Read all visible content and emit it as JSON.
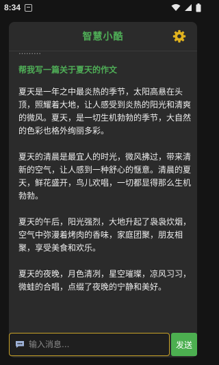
{
  "status_bar": {
    "time": "8:34"
  },
  "header": {
    "title": "智慧小酷"
  },
  "chat": {
    "previous_snippet": "………",
    "prompt": "帮我写一篇关于夏天的作文",
    "response_paragraphs": [
      "夏天是一年之中最炎热的季节，太阳高悬在头顶，照耀着大地，让人感受到炎热的阳光和清爽的微风。夏天，是一切生机勃勃的季节，大自然的色彩也格外绚丽多彩。",
      "夏天的清晨是最宜人的时光，微风拂过，带来清新的空气，让人感到一种舒心的惬意。清晨的夏天，鲜花盛开，鸟儿欢唱，一切都显得那么生机勃勃。",
      "夏天的午后，阳光强烈，大地升起了袅袅炊烟，空气中弥漫着烤肉的香味，家庭团聚，朋友相聚，享受美食和欢乐。",
      "夏天的夜晚，月色清冽，星空璀璨，凉风习习，微蛙的合唱，点缀了夜晚的宁静和美好。"
    ]
  },
  "input": {
    "placeholder": "输入消息...",
    "value": ""
  },
  "send_label": "发送",
  "colors": {
    "accent_green": "#4fae57",
    "input_border": "#c9a227",
    "gear": "#e0b21e"
  },
  "icons": [
    "notification-icon",
    "wifi-icon",
    "signal-icon",
    "battery-icon",
    "gear-icon",
    "chat-bubble-icon"
  ]
}
